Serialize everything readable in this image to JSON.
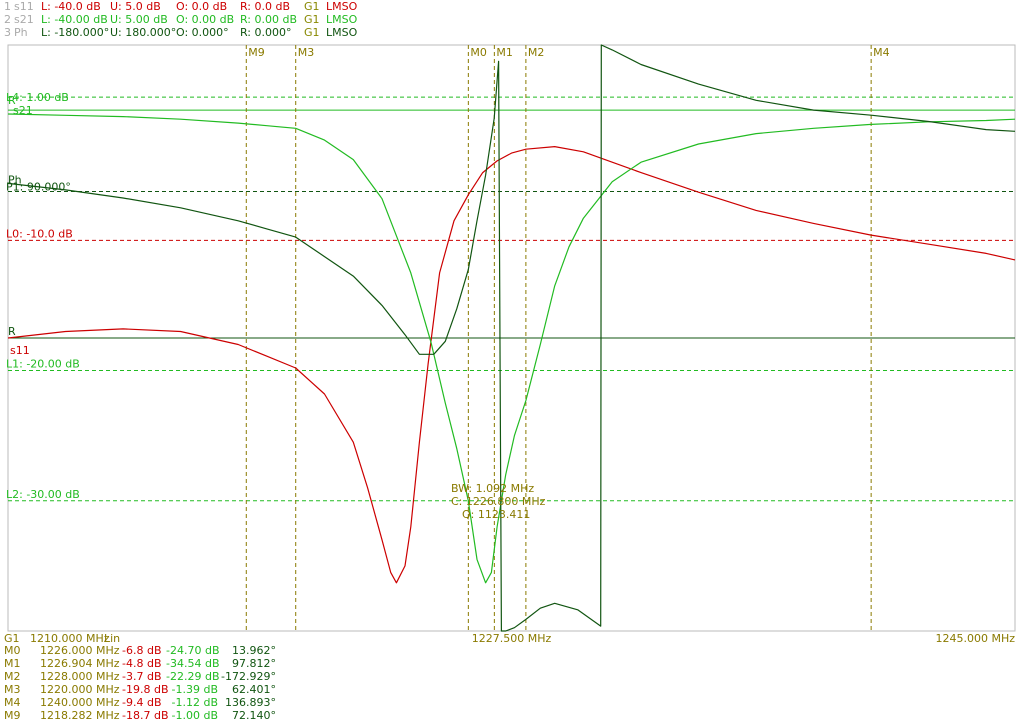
{
  "header": [
    {
      "idx": "1",
      "name": "s11",
      "lower": "L: -40.0 dB",
      "upper": "U: 5.0 dB",
      "offset": "O: 0.0 dB",
      "ref": "R: 0.0 dB",
      "group": "G1",
      "mode": "LMSO",
      "color": "#cc0000"
    },
    {
      "idx": "2",
      "name": "s21",
      "lower": "L: -40.00 dB",
      "upper": "U: 5.00 dB",
      "offset": "O: 0.00 dB",
      "ref": "R: 0.00 dB",
      "group": "G1",
      "mode": "LMSO",
      "color": "#22bb22"
    },
    {
      "idx": "3",
      "name": "Ph",
      "lower": "L: -180.000°",
      "upper": "U: 180.000°",
      "offset": "O: 0.000°",
      "ref": "R: 0.000°",
      "group": "G1",
      "mode": "LMSO",
      "color": "#115511"
    }
  ],
  "axis": {
    "group": "G1",
    "start": "1210.000 MHz",
    "scale": "Lin",
    "center": "1227.500 MHz",
    "stop": "1245.000 MHz"
  },
  "plot_labels": {
    "R_s21": "R",
    "s21_name": "s21",
    "L4": "L4: 1.00 dB",
    "Ph_name": "Ph",
    "Ph_level": "P1: 90.000°",
    "L0": "L0: -10.0 dB",
    "R_s11": "R",
    "s11_name": "s11",
    "L1": "L1: -20.00 dB",
    "L2": "L2: -30.00 dB"
  },
  "bandwidth": {
    "bw": "BW: 1.092 MHz",
    "center": "C: 1226.800 MHz",
    "q": "Q: 1123.411"
  },
  "markers_list": [
    {
      "name": "M0",
      "freq": "1226.000 MHz",
      "s11": "-6.8 dB",
      "s21": "-24.70 dB",
      "ph": "13.962°"
    },
    {
      "name": "M1",
      "freq": "1226.904 MHz",
      "s11": "-4.8 dB",
      "s21": "-34.54 dB",
      "ph": "97.812°"
    },
    {
      "name": "M2",
      "freq": "1228.000 MHz",
      "s11": "-3.7 dB",
      "s21": "-22.29 dB",
      "ph": "-172.929°"
    },
    {
      "name": "M3",
      "freq": "1220.000 MHz",
      "s11": "-19.8 dB",
      "s21": "-1.39 dB",
      "ph": "62.401°"
    },
    {
      "name": "M4",
      "freq": "1240.000 MHz",
      "s11": "-9.4 dB",
      "s21": "-1.12 dB",
      "ph": "136.893°"
    },
    {
      "name": "M9",
      "freq": "1218.282 MHz",
      "s11": "-18.7 dB",
      "s21": "-1.00 dB",
      "ph": "72.140°"
    }
  ],
  "colors": {
    "s11": "#cc0000",
    "s21": "#22bb22",
    "ph": "#115511",
    "marker": "#8a7a00",
    "grid_border": "#bbbbbb"
  },
  "chart_data": {
    "type": "line",
    "x_unit": "MHz",
    "xlim": [
      1210.0,
      1245.0
    ],
    "series": [
      {
        "name": "s11",
        "unit": "dB",
        "ylim": [
          -40.0,
          5.0
        ],
        "x": [
          1210,
          1212,
          1214,
          1216,
          1218,
          1219,
          1220,
          1221,
          1222,
          1222.5,
          1223,
          1223.3,
          1223.5,
          1223.8,
          1224,
          1224.3,
          1224.6,
          1225,
          1225.5,
          1226,
          1226.5,
          1227,
          1227.5,
          1228,
          1229,
          1230,
          1231,
          1232,
          1234,
          1236,
          1238,
          1240,
          1242,
          1244,
          1245
        ],
        "y": [
          -17.5,
          -17.0,
          -16.8,
          -17.0,
          -18.0,
          -18.9,
          -19.8,
          -21.8,
          -25.5,
          -29.0,
          -33.0,
          -35.5,
          -36.3,
          -35.0,
          -32.0,
          -25.5,
          -19.5,
          -12.5,
          -8.5,
          -6.5,
          -4.8,
          -3.9,
          -3.3,
          -3.0,
          -2.8,
          -3.2,
          -4.0,
          -4.8,
          -6.3,
          -7.7,
          -8.7,
          -9.6,
          -10.3,
          -11.0,
          -11.5
        ]
      },
      {
        "name": "s21",
        "unit": "dB",
        "ylim": [
          -40.0,
          5.0
        ],
        "x": [
          1210,
          1212,
          1214,
          1216,
          1218,
          1219,
          1220,
          1221,
          1222,
          1223,
          1224,
          1224.7,
          1225.2,
          1225.6,
          1226,
          1226.3,
          1226.6,
          1226.8,
          1227,
          1227.3,
          1227.6,
          1228,
          1228.5,
          1229,
          1229.5,
          1230,
          1231,
          1232,
          1234,
          1236,
          1238,
          1240,
          1242,
          1244,
          1245
        ],
        "y": [
          -0.3,
          -0.4,
          -0.5,
          -0.7,
          -1.0,
          -1.2,
          -1.4,
          -2.3,
          -3.8,
          -6.8,
          -12.5,
          -17.8,
          -22.5,
          -26.0,
          -30.0,
          -34.5,
          -36.3,
          -35.5,
          -32.0,
          -28.0,
          -25.0,
          -22.3,
          -18.0,
          -13.5,
          -10.5,
          -8.3,
          -5.5,
          -4.0,
          -2.6,
          -1.8,
          -1.4,
          -1.1,
          -0.9,
          -0.8,
          -0.7
        ]
      },
      {
        "name": "Ph",
        "unit": "deg",
        "ylim": [
          -180.0,
          180.0
        ],
        "x": [
          1210,
          1212,
          1214,
          1216,
          1218,
          1219,
          1220,
          1221,
          1222,
          1223,
          1223.8,
          1224.3,
          1224.8,
          1225.2,
          1225.6,
          1226,
          1226.3,
          1226.6,
          1226.9,
          1227.05,
          1227.15,
          1227.3,
          1227.6,
          1228,
          1228.5,
          1229,
          1229.8,
          1230.6,
          1230.62,
          1231,
          1232,
          1234,
          1236,
          1238,
          1240,
          1242,
          1244,
          1245
        ],
        "y": [
          95,
          91,
          86,
          80,
          72,
          67,
          62,
          50,
          38,
          20,
          2,
          -10,
          -10,
          -2,
          18,
          42,
          72,
          100,
          135,
          170,
          -180,
          -180,
          -178,
          -172.9,
          -166,
          -163,
          -167,
          -177,
          180,
          177,
          168,
          156,
          146,
          140,
          136.9,
          133,
          128,
          127
        ]
      }
    ],
    "hlines": [
      {
        "label": "L4: 1.00 dB",
        "value": 1.0,
        "axis": "dB"
      },
      {
        "label": "P1: 90.000°",
        "value": 90.0,
        "axis": "deg"
      },
      {
        "label": "L0: -10.0 dB",
        "value": -10.0,
        "axis": "dB"
      },
      {
        "label": "L1: -20.00 dB",
        "value": -20.0,
        "axis": "dB"
      },
      {
        "label": "L2: -30.00 dB",
        "value": -30.0,
        "axis": "dB"
      }
    ],
    "references": [
      {
        "label": "R",
        "value": 0.0,
        "axis": "dB"
      },
      {
        "label": "R",
        "value": 0.0,
        "axis": "deg"
      }
    ],
    "markers": [
      {
        "name": "M9",
        "x": 1218.282
      },
      {
        "name": "M3",
        "x": 1220.0
      },
      {
        "name": "M0",
        "x": 1226.0
      },
      {
        "name": "M1",
        "x": 1226.904
      },
      {
        "name": "M2",
        "x": 1228.0
      },
      {
        "name": "M4",
        "x": 1240.0
      }
    ]
  }
}
